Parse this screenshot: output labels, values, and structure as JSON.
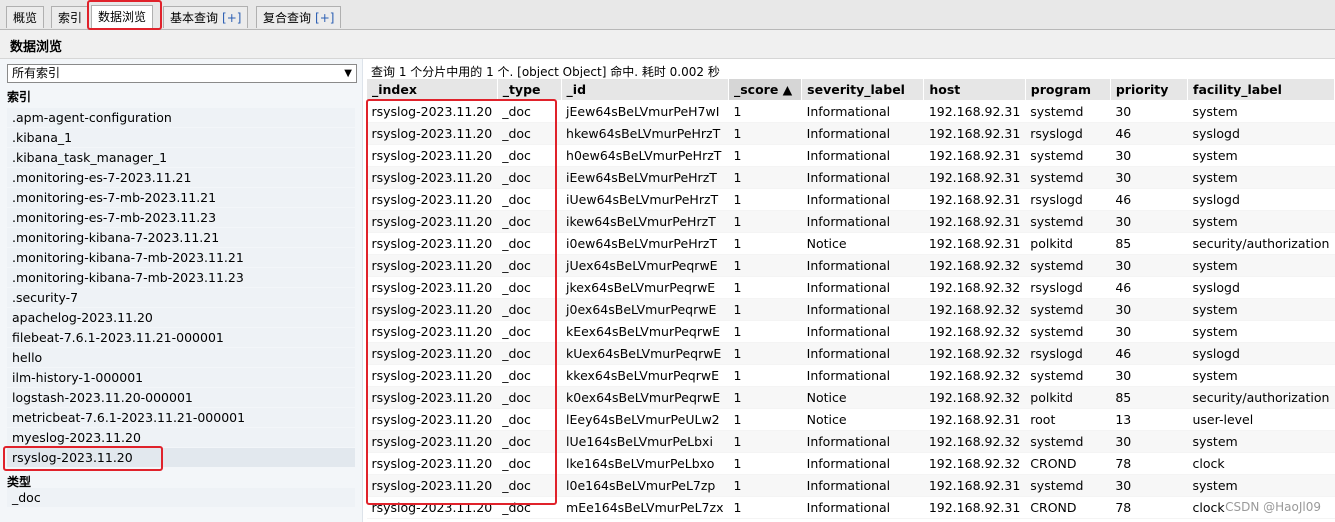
{
  "tabs": [
    {
      "label": "概览",
      "plus": ""
    },
    {
      "label": "索引",
      "plus": ""
    },
    {
      "label": "数据浏览",
      "plus": ""
    },
    {
      "label": "基本查询",
      "plus": "[+]"
    },
    {
      "label": "复合查询",
      "plus": "[+]"
    }
  ],
  "active_tab": "数据浏览",
  "page_title": "数据浏览",
  "sidebar": {
    "index_select_value": "所有索引",
    "indices_heading": "索引",
    "indices": [
      ".apm-agent-configuration",
      ".kibana_1",
      ".kibana_task_manager_1",
      ".monitoring-es-7-2023.11.21",
      ".monitoring-es-7-mb-2023.11.21",
      ".monitoring-es-7-mb-2023.11.23",
      ".monitoring-kibana-7-2023.11.21",
      ".monitoring-kibana-7-mb-2023.11.21",
      ".monitoring-kibana-7-mb-2023.11.23",
      ".security-7",
      "apachelog-2023.11.20",
      "filebeat-7.6.1-2023.11.21-000001",
      "hello",
      "ilm-history-1-000001",
      "logstash-2023.11.20-000001",
      "metricbeat-7.6.1-2023.11.21-000001",
      "myeslog-2023.11.20",
      "rsyslog-2023.11.20"
    ],
    "selected_index": "rsyslog-2023.11.20",
    "types_heading": "类型",
    "types": [
      "_doc"
    ]
  },
  "status_line": "查询 1 个分片中用的 1 个. [object Object] 命中. 耗时 0.002 秒",
  "table": {
    "columns": [
      "_index",
      "_type",
      "_id",
      "_score ▲",
      "severity_label",
      "host",
      "program",
      "priority",
      "facility_label"
    ],
    "sorted_column": 3,
    "rows": [
      [
        "rsyslog-2023.11.20",
        "_doc",
        "jEew64sBeLVmurPeH7wI",
        "1",
        "Informational",
        "192.168.92.31",
        "systemd",
        "30",
        "system"
      ],
      [
        "rsyslog-2023.11.20",
        "_doc",
        "hkew64sBeLVmurPeHrzT",
        "1",
        "Informational",
        "192.168.92.31",
        "rsyslogd",
        "46",
        "syslogd"
      ],
      [
        "rsyslog-2023.11.20",
        "_doc",
        "h0ew64sBeLVmurPeHrzT",
        "1",
        "Informational",
        "192.168.92.31",
        "systemd",
        "30",
        "system"
      ],
      [
        "rsyslog-2023.11.20",
        "_doc",
        "iEew64sBeLVmurPeHrzT",
        "1",
        "Informational",
        "192.168.92.31",
        "systemd",
        "30",
        "system"
      ],
      [
        "rsyslog-2023.11.20",
        "_doc",
        "iUew64sBeLVmurPeHrzT",
        "1",
        "Informational",
        "192.168.92.31",
        "rsyslogd",
        "46",
        "syslogd"
      ],
      [
        "rsyslog-2023.11.20",
        "_doc",
        "ikew64sBeLVmurPeHrzT",
        "1",
        "Informational",
        "192.168.92.31",
        "systemd",
        "30",
        "system"
      ],
      [
        "rsyslog-2023.11.20",
        "_doc",
        "i0ew64sBeLVmurPeHrzT",
        "1",
        "Notice",
        "192.168.92.31",
        "polkitd",
        "85",
        "security/authorization"
      ],
      [
        "rsyslog-2023.11.20",
        "_doc",
        "jUex64sBeLVmurPeqrwE",
        "1",
        "Informational",
        "192.168.92.32",
        "systemd",
        "30",
        "system"
      ],
      [
        "rsyslog-2023.11.20",
        "_doc",
        "jkex64sBeLVmurPeqrwE",
        "1",
        "Informational",
        "192.168.92.32",
        "rsyslogd",
        "46",
        "syslogd"
      ],
      [
        "rsyslog-2023.11.20",
        "_doc",
        "j0ex64sBeLVmurPeqrwE",
        "1",
        "Informational",
        "192.168.92.32",
        "systemd",
        "30",
        "system"
      ],
      [
        "rsyslog-2023.11.20",
        "_doc",
        "kEex64sBeLVmurPeqrwE",
        "1",
        "Informational",
        "192.168.92.32",
        "systemd",
        "30",
        "system"
      ],
      [
        "rsyslog-2023.11.20",
        "_doc",
        "kUex64sBeLVmurPeqrwE",
        "1",
        "Informational",
        "192.168.92.32",
        "rsyslogd",
        "46",
        "syslogd"
      ],
      [
        "rsyslog-2023.11.20",
        "_doc",
        "kkex64sBeLVmurPeqrwE",
        "1",
        "Informational",
        "192.168.92.32",
        "systemd",
        "30",
        "system"
      ],
      [
        "rsyslog-2023.11.20",
        "_doc",
        "k0ex64sBeLVmurPeqrwE",
        "1",
        "Notice",
        "192.168.92.32",
        "polkitd",
        "85",
        "security/authorization"
      ],
      [
        "rsyslog-2023.11.20",
        "_doc",
        "lEey64sBeLVmurPeULw2",
        "1",
        "Notice",
        "192.168.92.31",
        "root",
        "13",
        "user-level"
      ],
      [
        "rsyslog-2023.11.20",
        "_doc",
        "lUe164sBeLVmurPeLbxi",
        "1",
        "Informational",
        "192.168.92.32",
        "systemd",
        "30",
        "system"
      ],
      [
        "rsyslog-2023.11.20",
        "_doc",
        "lke164sBeLVmurPeLbxo",
        "1",
        "Informational",
        "192.168.92.32",
        "CROND",
        "78",
        "clock"
      ],
      [
        "rsyslog-2023.11.20",
        "_doc",
        "l0e164sBeLVmurPeL7zp",
        "1",
        "Informational",
        "192.168.92.31",
        "systemd",
        "30",
        "system"
      ],
      [
        "rsyslog-2023.11.20",
        "_doc",
        "mEe164sBeLVmurPeL7zx",
        "1",
        "Informational",
        "192.168.92.31",
        "CROND",
        "78",
        "clock"
      ]
    ]
  },
  "watermark": "CSDN @HaoJl09",
  "colors": {
    "highlight": "#e0222b",
    "link": "#2c5fb3"
  }
}
